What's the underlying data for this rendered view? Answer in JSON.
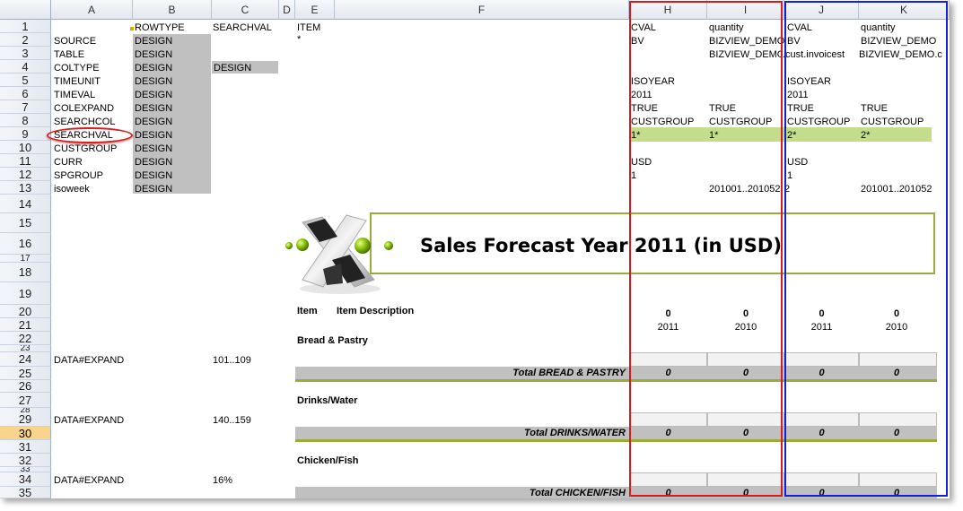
{
  "col_headers": [
    "A",
    "B",
    "C",
    "D",
    "E",
    "F",
    "H",
    "I",
    "J",
    "K"
  ],
  "row_headers": [
    "1",
    "2",
    "3",
    "4",
    "5",
    "6",
    "7",
    "8",
    "9",
    "10",
    "11",
    "12",
    "13",
    "14",
    "15",
    "16",
    "17",
    "18",
    "19",
    "20",
    "21",
    "22",
    "23",
    "24",
    "25",
    "26",
    "27",
    "28",
    "29",
    "30",
    "31",
    "32",
    "33",
    "34",
    "35"
  ],
  "selected_row": "30",
  "col_a": {
    "r2": "SOURCE",
    "r3": "TABLE",
    "r4": "COLTYPE",
    "r5": "TIMEUNIT",
    "r6": "TIMEVAL",
    "r7": "COLEXPAND",
    "r8": "SEARCHCOL",
    "r9": "SEARCHVAL",
    "r10": "CUSTGROUP",
    "r11": "CURR",
    "r12": "SPGROUP",
    "r13": "isoweek",
    "r24": "DATA#EXPAND",
    "r29": "DATA#EXPAND",
    "r34": "DATA#EXPAND"
  },
  "col_b": {
    "header": "ROWTYPE",
    "design": "DESIGN"
  },
  "col_c": {
    "header": "SEARCHVAL",
    "r4": "DESIGN",
    "r24": "101..109",
    "r29": "140..159",
    "r34": "16%"
  },
  "col_e": {
    "r1": "ITEM",
    "r2": "*"
  },
  "col_h": {
    "r1": "CVAL",
    "r2": "BV",
    "r5": "ISOYEAR",
    "r6": "2011",
    "r7": "TRUE",
    "r8": "CUSTGROUP",
    "r9": "1*",
    "r11": "USD",
    "r12": "1"
  },
  "col_i": {
    "r1": "quantity",
    "r2": "BIZVIEW_DEMO",
    "r3": "BIZVIEW_DEMO",
    "r7": "TRUE",
    "r8": "CUSTGROUP",
    "r9": "1*",
    "r13": "201001..201052"
  },
  "col_j": {
    "r1": "CVAL",
    "r2": "BV",
    "r3": ".cust.invoicest",
    "r5": "ISOYEAR",
    "r6": "2011",
    "r7": "TRUE",
    "r8": "CUSTGROUP",
    "r9": "2*",
    "r11": "USD",
    "r12": "1",
    "r13": "2"
  },
  "col_k": {
    "r1": "quantity",
    "r2": "BIZVIEW_DEMO",
    "r3": "BIZVIEW_DEMO.c",
    "r7": "TRUE",
    "r8": "CUSTGROUP",
    "r9": "2*",
    "r13": "201001..201052"
  },
  "report": {
    "title": "Sales Forecast Year 2011 (in USD)",
    "item_header": "Item",
    "desc_header": "Item Description",
    "col_values": [
      "0",
      "0",
      "0",
      "0"
    ],
    "col_years": [
      "2011",
      "2010",
      "2011",
      "2010"
    ],
    "groups": [
      {
        "name": "Bread & Pastry",
        "total": "Total BREAD & PASTRY",
        "values": [
          "0",
          "0",
          "0",
          "0"
        ]
      },
      {
        "name": "Drinks/Water",
        "total": "Total DRINKS/WATER",
        "values": [
          "0",
          "0",
          "0",
          "0"
        ]
      },
      {
        "name": "Chicken/Fish",
        "total": "Total CHICKEN/FISH",
        "values": [
          "0",
          "0",
          "0",
          "0"
        ]
      }
    ]
  },
  "colors": {
    "highlight_red": "#d71920",
    "highlight_blue": "#1420d7",
    "band_gray": "#c0c0c0",
    "green_row": "#c4dd8d",
    "accent_olive": "#9aab3c"
  }
}
